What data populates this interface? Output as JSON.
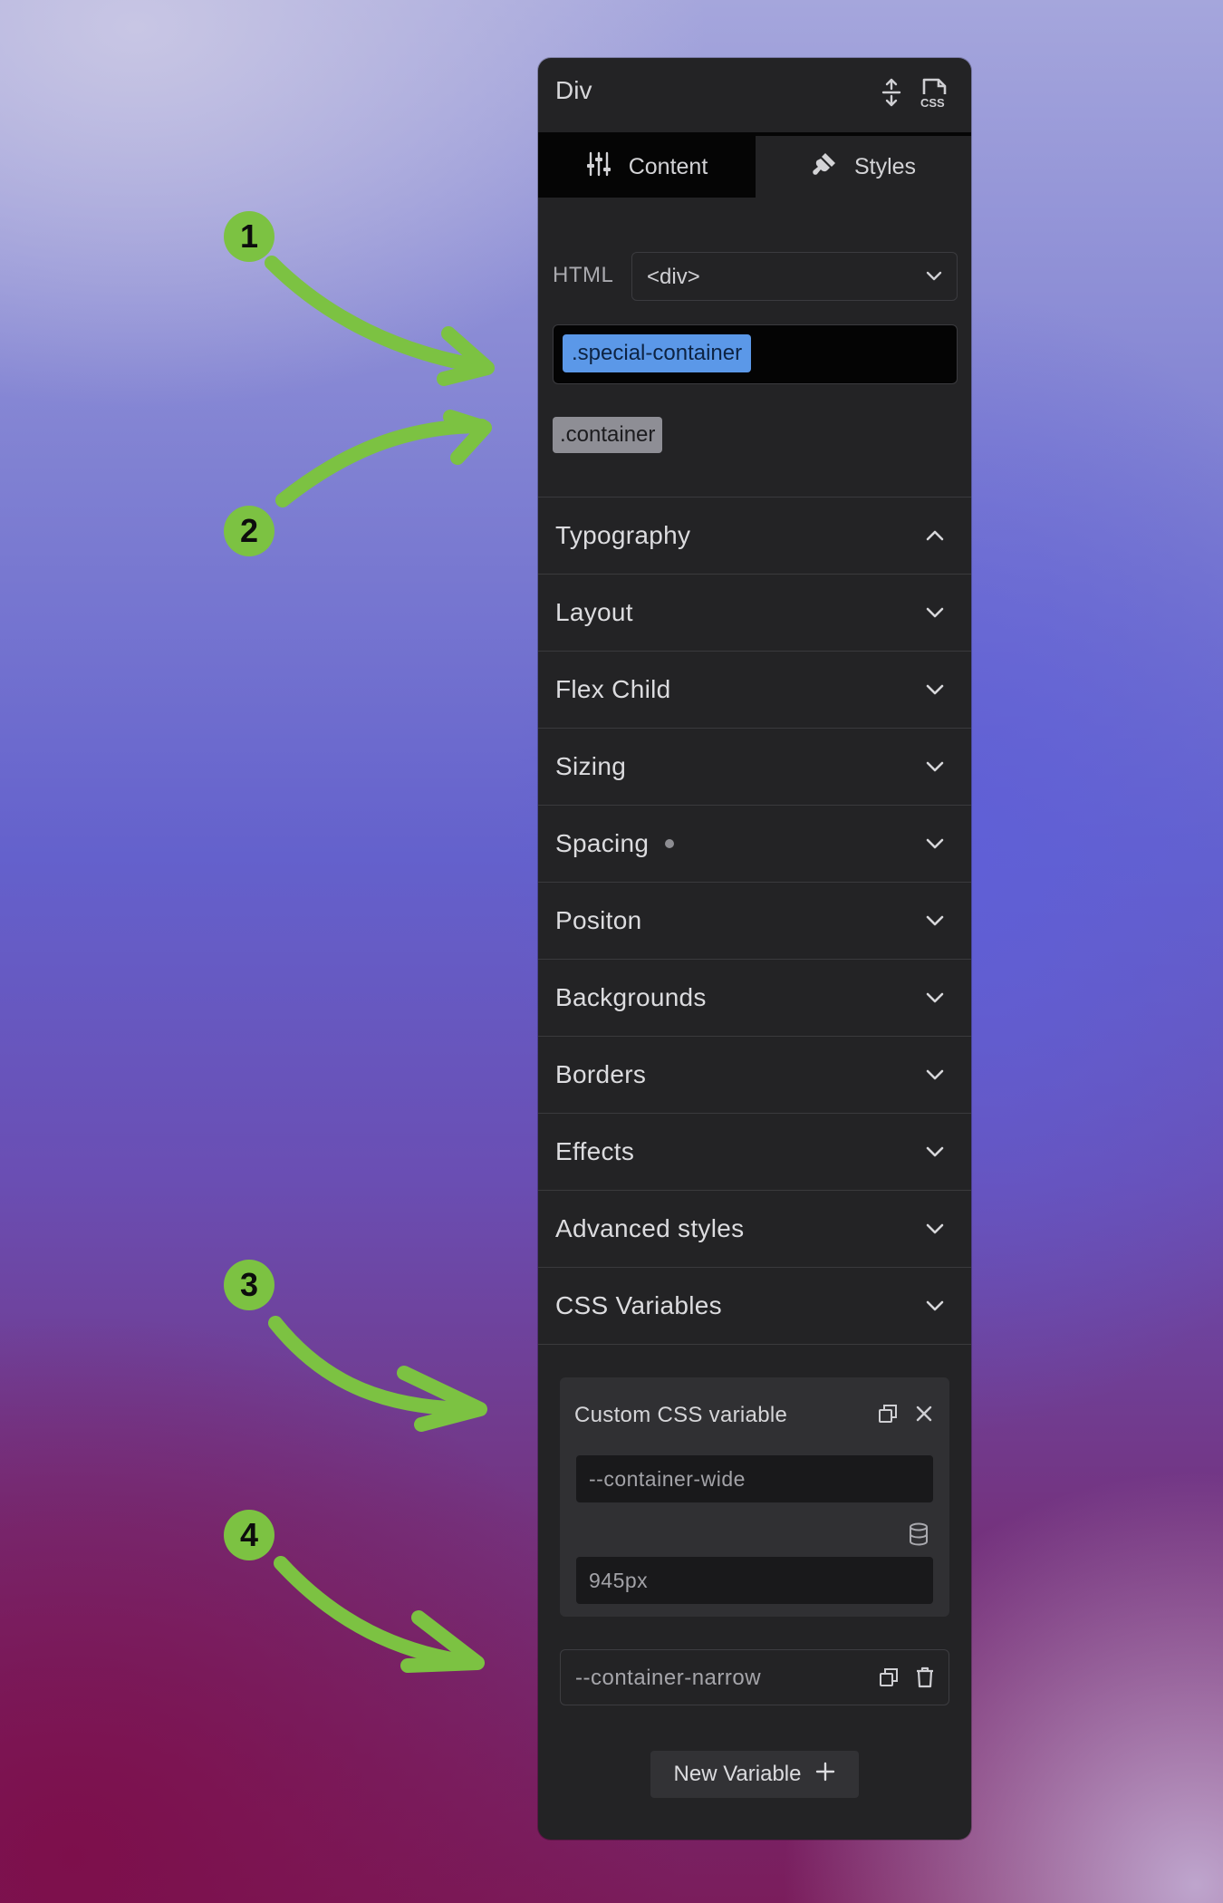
{
  "panel": {
    "title": "Div",
    "icons": {
      "collapse": "expand-collapse-icon",
      "css": "css-file-icon"
    },
    "tabs": [
      {
        "label": "Content",
        "icon": "sliders-icon",
        "active": false
      },
      {
        "label": "Styles",
        "icon": "brush-icon",
        "active": true
      }
    ],
    "html_tag": {
      "label": "HTML",
      "value": "<div>"
    },
    "classes": {
      "active": ".special-container",
      "inherited": ".container"
    },
    "sections": [
      {
        "label": "Typography",
        "expanded": true
      },
      {
        "label": "Layout"
      },
      {
        "label": "Flex Child"
      },
      {
        "label": "Sizing"
      },
      {
        "label": "Spacing",
        "has_indicator": true
      },
      {
        "label": "Positon"
      },
      {
        "label": "Backgrounds"
      },
      {
        "label": "Borders"
      },
      {
        "label": "Effects"
      },
      {
        "label": "Advanced styles"
      },
      {
        "label": "CSS Variables"
      }
    ],
    "css_variables": {
      "card_title": "Custom CSS variable",
      "name_value": "--container-wide",
      "value_value": "945px",
      "collapsed_item": "--container-narrow",
      "new_button": "New Variable"
    }
  },
  "annotations": [
    "1",
    "2",
    "3",
    "4"
  ],
  "colors": {
    "annotation_green": "#7cc242",
    "panel_bg": "#232325",
    "active_chip": "#5b98e8",
    "inactive_chip": "#8e8e95"
  }
}
